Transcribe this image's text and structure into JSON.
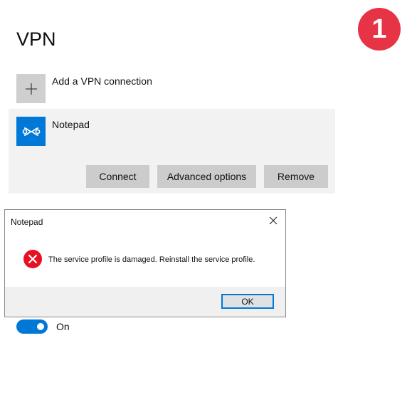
{
  "page": {
    "title": "VPN"
  },
  "badge": {
    "number": "1",
    "color": "#e63345"
  },
  "add_connection": {
    "icon": "plus-icon",
    "label": "Add a VPN connection"
  },
  "vpn": {
    "name": "Notepad",
    "icon": "vpn-link-icon",
    "accent": "#0078d7",
    "buttons": {
      "connect": "Connect",
      "advanced": "Advanced options",
      "remove": "Remove"
    }
  },
  "dialog": {
    "title": "Notepad",
    "icon": "error-icon",
    "message": "The service profile is damaged. Reinstall the service profile.",
    "ok_label": "OK"
  },
  "toggle": {
    "state": "On",
    "color": "#0078d7"
  }
}
